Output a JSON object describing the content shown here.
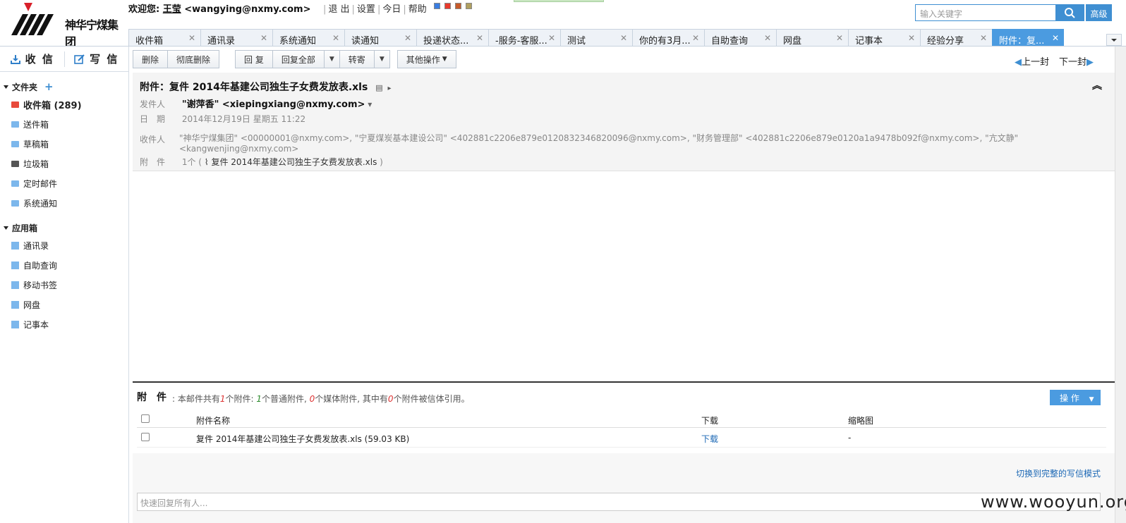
{
  "header": {
    "logo_text": "神华宁煤集团",
    "welcome_prefix": "欢迎您: ",
    "user_name": "王莹",
    "user_email": " <wangying@nxmy.com>",
    "links": [
      "退 出",
      "设置",
      "今日",
      "帮助"
    ],
    "skin_colors": [
      "#3a7de0",
      "#e83a2b",
      "#c65a2b",
      "#b0a060"
    ],
    "search_placeholder": "输入关键字",
    "advanced_label": "高级"
  },
  "tabs": [
    {
      "label": "收件箱"
    },
    {
      "label": "通讯录"
    },
    {
      "label": "系统通知"
    },
    {
      "label": "读通知"
    },
    {
      "label": "投递状态..."
    },
    {
      "label": "-服务-客服..."
    },
    {
      "label": "测试"
    },
    {
      "label": "你的有3月..."
    },
    {
      "label": "自助查询"
    },
    {
      "label": "网盘"
    },
    {
      "label": "记事本"
    },
    {
      "label": "经验分享"
    },
    {
      "label": "附件：复..."
    }
  ],
  "sidebar": {
    "receive_label": "收 信",
    "write_label": "写 信",
    "folders_title": "文件夹",
    "folders": [
      {
        "label": "收件箱 (289)"
      },
      {
        "label": "送件箱"
      },
      {
        "label": "草稿箱"
      },
      {
        "label": "垃圾箱"
      },
      {
        "label": "定时邮件"
      },
      {
        "label": "系统通知"
      }
    ],
    "apps_title": "应用箱",
    "apps": [
      {
        "label": "通讯录"
      },
      {
        "label": "自助查询"
      },
      {
        "label": "移动书签"
      },
      {
        "label": "网盘"
      },
      {
        "label": "记事本"
      }
    ]
  },
  "toolbar": {
    "delete": "删除",
    "delete_permanent": "彻底删除",
    "reply": "回 复",
    "reply_all": "回复全部",
    "forward": "转寄",
    "other_ops": "其他操作",
    "prev": "上一封",
    "next": "下一封"
  },
  "mail": {
    "subject": "附件：复件 2014年基建公司独生子女费发放表.xls",
    "sender_label": "发件人",
    "sender": "\"谢萍香\" <xiepingxiang@nxmy.com>",
    "date_label": "日　期",
    "date": "2014年12月19日 星期五 11:22",
    "recipients_label": "收件人",
    "recipients": "\"神华宁煤集团\" <00000001@nxmy.com>, \"宁夏煤炭基本建设公司\" <402881c2206e879e0120832346820096@nxmy.com>, \"财务管理部\" <402881c2206e879e0120a1a9478b092f@nxmy.com>, \"亢文静\" <kangwenjing@nxmy.com>",
    "attach_label": "附　件",
    "attach_count": "1个 (",
    "attach_name": "复件 2014年基建公司独生子女费发放表.xls",
    "attach_close": " )"
  },
  "attachments": {
    "title": "附　件",
    "summary_1": ": 本邮件共有",
    "total": "1",
    "summary_2": "个附件: ",
    "normal": "1",
    "summary_3": "个普通附件, ",
    "media": "0",
    "summary_4": "个媒体附件, 其中有",
    "referenced": "0",
    "summary_5": "个附件被信体引用。",
    "op_label": "操 作",
    "col_name": "附件名称",
    "col_download": "下载",
    "col_thumb": "缩略图",
    "rows": [
      {
        "name": "复件 2014年基建公司独生子女费发放表.xls (59.03 KB)",
        "download": "下载",
        "thumb": "-"
      }
    ]
  },
  "reply": {
    "switch_link": "切换到完整的写信模式",
    "placeholder": "快速回复所有人..."
  },
  "watermark": "www.wooyun.org"
}
